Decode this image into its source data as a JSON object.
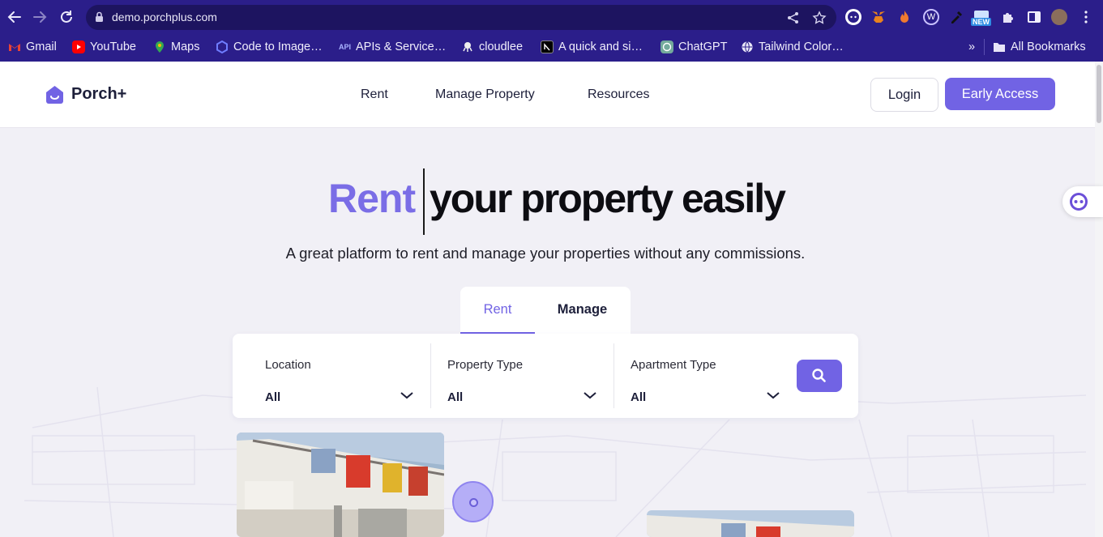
{
  "browser": {
    "url": "demo.porchplus.com",
    "new_badge": "NEW",
    "bookmarks": [
      {
        "label": "Gmail",
        "icon": "gmail-icon"
      },
      {
        "label": "YouTube",
        "icon": "youtube-icon"
      },
      {
        "label": "Maps",
        "icon": "maps-icon"
      },
      {
        "label": "Code to Image…",
        "icon": "code-icon"
      },
      {
        "label": "APIs & Service…",
        "icon": "api-icon"
      },
      {
        "label": "cloudlee",
        "icon": "octopus-icon"
      },
      {
        "label": "A quick and si…",
        "icon": "nextjs-icon"
      },
      {
        "label": "ChatGPT",
        "icon": "chatgpt-icon"
      },
      {
        "label": "Tailwind Color…",
        "icon": "globe-icon"
      }
    ],
    "api_badge": "API",
    "all_bookmarks": "All Bookmarks",
    "overflow": "»"
  },
  "header": {
    "brand": "Porch+",
    "nav": [
      "Rent",
      "Manage Property",
      "Resources"
    ],
    "login": "Login",
    "early_access": "Early Access"
  },
  "hero": {
    "title_accent": "Rent",
    "title_rest": "your property easily",
    "subtitle": "A great platform to rent and manage your properties without any commissions."
  },
  "search": {
    "tabs": [
      "Rent",
      "Manage"
    ],
    "active_tab": "Rent",
    "fields": [
      {
        "label": "Location",
        "value": "All"
      },
      {
        "label": "Property Type",
        "value": "All"
      },
      {
        "label": "Apartment Type",
        "value": "All"
      }
    ]
  },
  "colors": {
    "chrome": "#2b1e8a",
    "accent": "#7163e4",
    "page_bg": "#f1f0f6"
  }
}
